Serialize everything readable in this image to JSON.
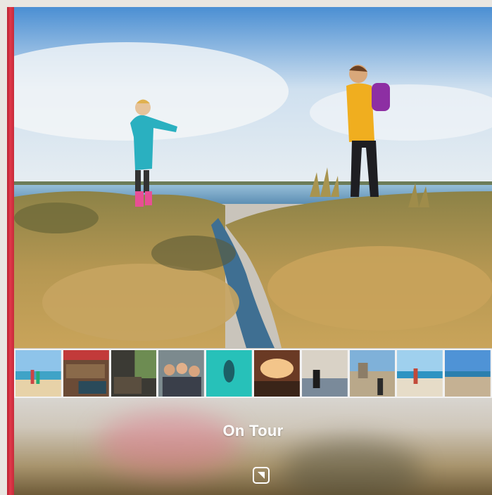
{
  "book": {
    "title": "On Tour",
    "spine_color": "#d8313f",
    "logo_icon": "photobook-logo-icon"
  },
  "hero_photo": {
    "subject": "child-and-hiker-on-grassy-marsh",
    "icon": "landscape-photo"
  },
  "thumbnails": [
    {
      "icon": "beach-photo"
    },
    {
      "icon": "hostel-photo"
    },
    {
      "icon": "cafe-photo"
    },
    {
      "icon": "group-selfie-photo"
    },
    {
      "icon": "snorkel-photo"
    },
    {
      "icon": "sunset-deck-photo"
    },
    {
      "icon": "silhouette-photo"
    },
    {
      "icon": "ruins-photo"
    },
    {
      "icon": "surfer-photo"
    },
    {
      "icon": "coast-photo"
    }
  ]
}
